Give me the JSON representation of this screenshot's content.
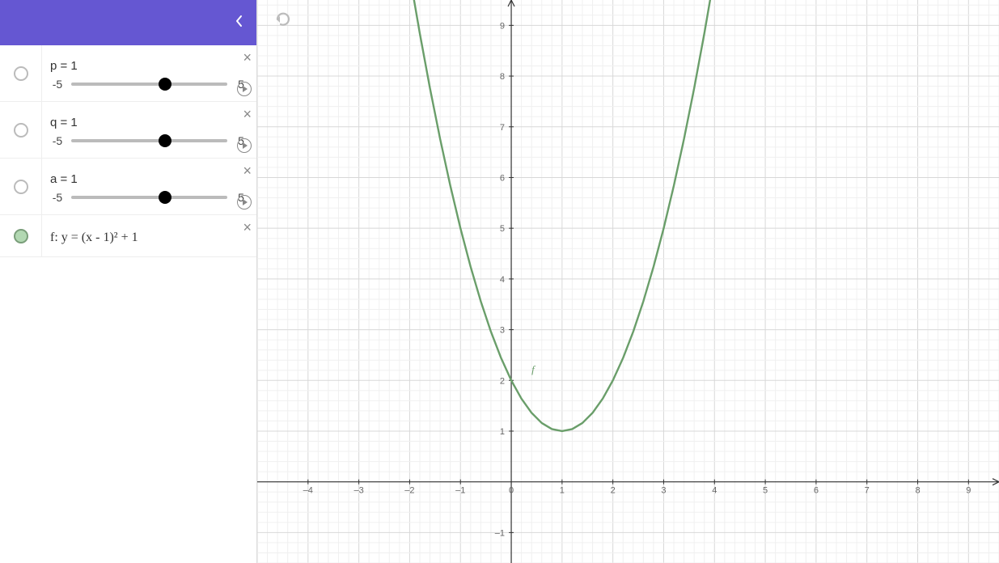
{
  "sidebar": {
    "params": [
      {
        "name": "p",
        "value": 1,
        "min": -5,
        "max": 5,
        "label": "p = 1",
        "min_label": "-5",
        "max_label": "5"
      },
      {
        "name": "q",
        "value": 1,
        "min": -5,
        "max": 5,
        "label": "q = 1",
        "min_label": "-5",
        "max_label": "5"
      },
      {
        "name": "a",
        "value": 1,
        "min": -5,
        "max": 5,
        "label": "a = 1",
        "min_label": "-5",
        "max_label": "5"
      }
    ],
    "function_row": {
      "label": "f: y = (x - 1)² + 1",
      "color": "#6a9e6a"
    }
  },
  "graph": {
    "x_range": [
      -5,
      9.6
    ],
    "y_range": [
      -1.6,
      9.5
    ],
    "x_ticks": [
      -4,
      -3,
      -2,
      -1,
      0,
      1,
      2,
      3,
      4,
      5,
      6,
      7,
      8,
      9
    ],
    "y_ticks": [
      -1,
      1,
      2,
      3,
      4,
      5,
      6,
      7,
      8,
      9
    ],
    "curve_label": "f"
  },
  "chart_data": {
    "type": "line",
    "title": "",
    "xlabel": "",
    "ylabel": "",
    "xlim": [
      -5,
      9.6
    ],
    "ylim": [
      -1.6,
      9.5
    ],
    "grid": true,
    "series": [
      {
        "name": "f",
        "color": "#6a9e6a",
        "formula": "y = (x - 1)^2 + 1",
        "x": [
          -2.0,
          -1.8,
          -1.6,
          -1.4,
          -1.2,
          -1.0,
          -0.8,
          -0.6,
          -0.4,
          -0.2,
          0.0,
          0.2,
          0.4,
          0.6,
          0.8,
          1.0,
          1.2,
          1.4,
          1.6,
          1.8,
          2.0,
          2.2,
          2.4,
          2.6,
          2.8,
          3.0,
          3.2,
          3.4,
          3.6,
          3.8,
          4.0
        ],
        "y": [
          10.0,
          8.84,
          7.76,
          6.76,
          5.84,
          5.0,
          4.24,
          3.56,
          2.96,
          2.44,
          2.0,
          1.64,
          1.36,
          1.16,
          1.04,
          1.0,
          1.04,
          1.16,
          1.36,
          1.64,
          2.0,
          2.44,
          2.96,
          3.56,
          4.24,
          5.0,
          5.84,
          6.76,
          7.76,
          8.84,
          10.0
        ]
      }
    ]
  }
}
